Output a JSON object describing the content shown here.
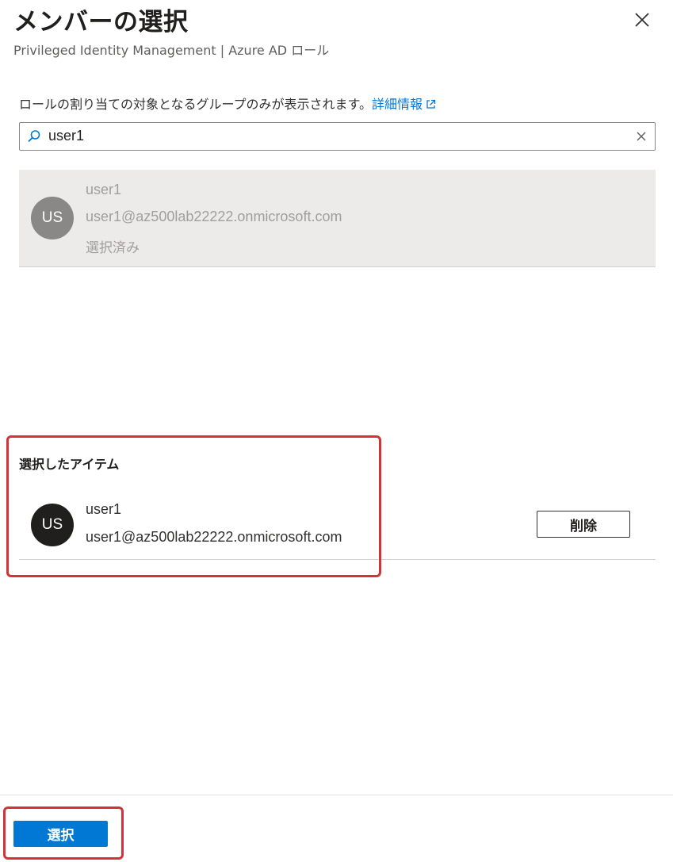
{
  "header": {
    "title": "メンバーの選択",
    "subtitle": "Privileged Identity Management | Azure AD ロール"
  },
  "info": {
    "text": "ロールの割り当ての対象となるグループのみが表示されます。",
    "link_label": "詳細情報"
  },
  "search": {
    "value": "user1",
    "placeholder": ""
  },
  "results": [
    {
      "initials": "US",
      "name": "user1",
      "email": "user1@az500lab22222.onmicrosoft.com",
      "status": "選択済み"
    }
  ],
  "selected": {
    "heading": "選択したアイテム",
    "items": [
      {
        "initials": "US",
        "name": "user1",
        "email": "user1@az500lab22222.onmicrosoft.com",
        "remove_label": "削除"
      }
    ]
  },
  "footer": {
    "select_label": "選択"
  },
  "colors": {
    "accent": "#0078d4",
    "highlight": "#d13438",
    "result_background": "#edebe9"
  },
  "icons": {
    "close": "close-icon",
    "search": "search-icon",
    "clear": "clear-icon",
    "external_link": "external-link-icon"
  }
}
